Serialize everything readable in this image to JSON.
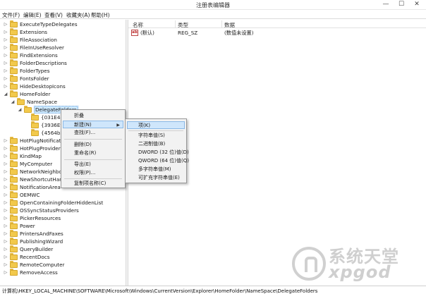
{
  "window": {
    "title": "注册表编辑器",
    "minimize": "—",
    "maximize": "☐",
    "close": "✕"
  },
  "menu": [
    "文件(F)",
    "编辑(E)",
    "查看(V)",
    "收藏夹(A)",
    "帮助(H)"
  ],
  "tree": [
    {
      "label": "ExecuteTypeDelegates"
    },
    {
      "label": "Extensions"
    },
    {
      "label": "FileAssociation"
    },
    {
      "label": "FileInUseResolver"
    },
    {
      "label": "FindExtensions"
    },
    {
      "label": "FolderDescriptions"
    },
    {
      "label": "FolderTypes"
    },
    {
      "label": "FontsFolder"
    },
    {
      "label": "HideDesktopIcons"
    },
    {
      "label": "HomeFolder"
    },
    {
      "label": "NameSpace"
    },
    {
      "label": "DelegateFolders"
    },
    {
      "label": "{031E482"
    },
    {
      "label": "{3936E98"
    },
    {
      "label": "{4564b25"
    },
    {
      "label": "HotPlugNotificatio"
    },
    {
      "label": "HotPlugProvider"
    },
    {
      "label": "KindMap"
    },
    {
      "label": "MyComputer"
    },
    {
      "label": "NetworkNeighbor"
    },
    {
      "label": "NewShortcutHandl"
    },
    {
      "label": "NotificationArea"
    },
    {
      "label": "OEMWC"
    },
    {
      "label": "OpenContainingFolderHiddenList"
    },
    {
      "label": "OSSyncStatusProviders"
    },
    {
      "label": "PickerResources"
    },
    {
      "label": "Power"
    },
    {
      "label": "PrintersAndFaxes"
    },
    {
      "label": "PublishingWizard"
    },
    {
      "label": "QueryBuilder"
    },
    {
      "label": "RecentDocs"
    },
    {
      "label": "RemoteComputer"
    },
    {
      "label": "RemoveAccess"
    }
  ],
  "list": {
    "columns": [
      "名称",
      "类型",
      "数据"
    ],
    "rows": [
      {
        "icon": "ab",
        "name": "(默认)",
        "type": "REG_SZ",
        "data": "(数值未设置)"
      }
    ]
  },
  "context_menu": [
    "折叠",
    "新建(N)",
    "查找(F)...",
    "删除(D)",
    "重命名(R)",
    "导出(E)",
    "权限(P)...",
    "复制项名称(C)"
  ],
  "submenu": [
    "项(K)",
    "字符串值(S)",
    "二进制值(B)",
    "DWORD (32 位)值(D)",
    "QWORD (64 位)值(Q)",
    "多字符串值(M)",
    "可扩充字符串值(E)"
  ],
  "status": {
    "path": "计算机\\HKEY_LOCAL_MACHINE\\SOFTWARE\\Microsoft\\Windows\\CurrentVersion\\Explorer\\HomeFolder\\NameSpace\\DelegateFolders"
  },
  "watermark": {
    "cn": "系统天堂",
    "en": "xpgod"
  },
  "colors": {
    "selection": "#cce8ff",
    "menu_highlight": "#cfe6fb",
    "folder": "#f2c94c"
  }
}
